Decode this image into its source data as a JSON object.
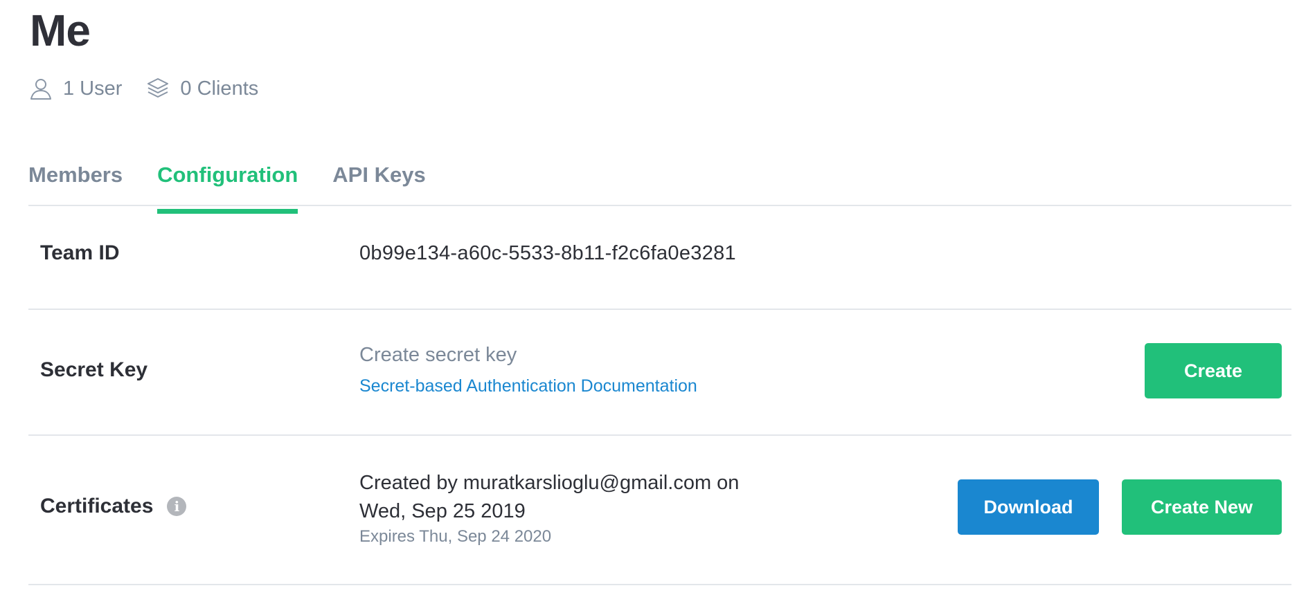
{
  "team": {
    "title": "Me",
    "users_label": "1 User",
    "clients_label": "0 Clients"
  },
  "tabs": [
    {
      "label": "Members",
      "active": false
    },
    {
      "label": "Configuration",
      "active": true
    },
    {
      "label": "API Keys",
      "active": false
    }
  ],
  "config": {
    "team_id": {
      "label": "Team ID",
      "value": "0b99e134-a60c-5533-8b11-f2c6fa0e3281"
    },
    "secret_key": {
      "label": "Secret Key",
      "title": "Create secret key",
      "doc_link": "Secret-based Authentication Documentation",
      "create_button": "Create"
    },
    "certificates": {
      "label": "Certificates",
      "created_line": "Created by muratkarslioglu@gmail.com on",
      "created_date": "Wed, Sep 25 2019",
      "expires": "Expires Thu, Sep 24 2020",
      "download_button": "Download",
      "create_new_button": "Create New"
    }
  },
  "icons": {
    "user": "user-icon",
    "clients": "layers-icon",
    "info": "info-icon"
  },
  "colors": {
    "accent": "#21c07a",
    "link": "#1a87d0",
    "muted": "#7b8898",
    "text": "#2d2f36"
  }
}
